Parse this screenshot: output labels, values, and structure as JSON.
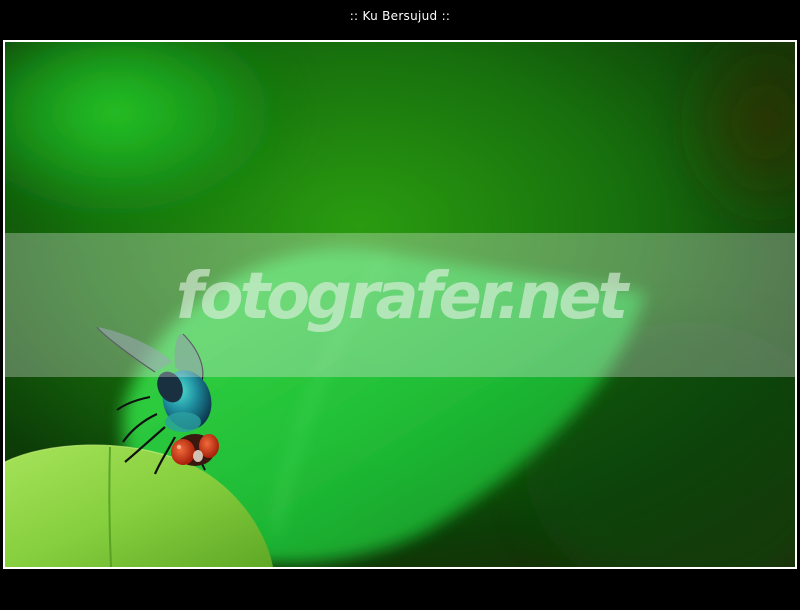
{
  "header": {
    "title": ":: Ku Bersujud ::"
  },
  "photo": {
    "watermark": "fotografer.net",
    "subject_icon": "fly-on-leaf-photo"
  },
  "colors": {
    "background": "#000000",
    "frame": "#ffffff",
    "leaf_light": "#8fd44a",
    "leaf_mid": "#2fcf3a",
    "background_green": "#1a9a12"
  }
}
